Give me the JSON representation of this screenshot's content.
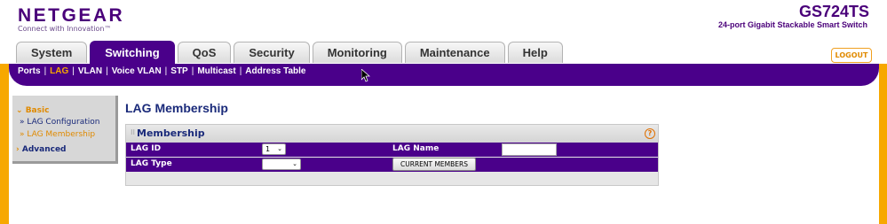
{
  "brand": {
    "name": "NETGEAR",
    "tagline": "Connect with Innovation™"
  },
  "device": {
    "model": "GS724TS",
    "description": "24-port Gigabit Stackable Smart Switch"
  },
  "tabs": [
    {
      "label": "System",
      "active": false
    },
    {
      "label": "Switching",
      "active": true
    },
    {
      "label": "QoS",
      "active": false
    },
    {
      "label": "Security",
      "active": false
    },
    {
      "label": "Monitoring",
      "active": false
    },
    {
      "label": "Maintenance",
      "active": false
    },
    {
      "label": "Help",
      "active": false
    }
  ],
  "logout_label": "LOGOUT",
  "subnav": [
    {
      "label": "Ports",
      "active": false
    },
    {
      "label": "LAG",
      "active": true
    },
    {
      "label": "VLAN",
      "active": false
    },
    {
      "label": "Voice VLAN",
      "active": false
    },
    {
      "label": "STP",
      "active": false
    },
    {
      "label": "Multicast",
      "active": false
    },
    {
      "label": "Address Table",
      "active": false
    }
  ],
  "sidebar": {
    "basic_label": "Basic",
    "items": [
      {
        "label": "» LAG Configuration",
        "active": false
      },
      {
        "label": "» LAG Membership",
        "active": true
      }
    ],
    "advanced_label": "Advanced"
  },
  "page_title": "LAG Membership",
  "panel": {
    "title": "Membership",
    "lag_id_label": "LAG ID",
    "lag_id_value": "1",
    "lag_name_label": "LAG Name",
    "lag_name_value": "",
    "lag_type_label": "LAG Type",
    "lag_type_value": "",
    "current_members_label": "CURRENT MEMBERS"
  },
  "colors": {
    "brand_purple": "#4a008a",
    "accent_orange": "#f7a800",
    "title_blue": "#1a2a7a"
  }
}
